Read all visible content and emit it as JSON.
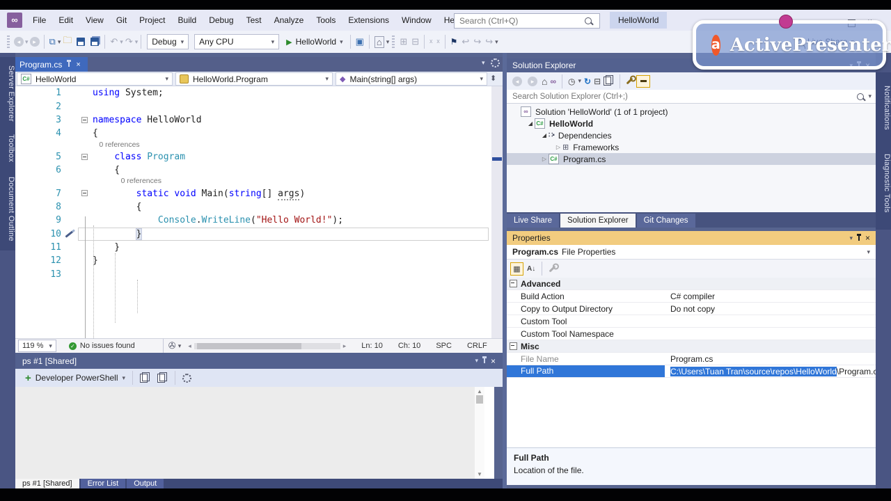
{
  "window": {
    "search_placeholder": "Search (Ctrl+Q)",
    "project_chip": "HelloWorld",
    "vs_logo": "VS"
  },
  "menu_items": [
    "File",
    "Edit",
    "View",
    "Git",
    "Project",
    "Build",
    "Debug",
    "Test",
    "Analyze",
    "Tools",
    "Extensions",
    "Window",
    "Help"
  ],
  "toolbar": {
    "config": "Debug",
    "platform": "Any CPU",
    "run_target": "HelloWorld",
    "live_share": "Live Share"
  },
  "watermark": {
    "brand": "ActivePresenter",
    "logo_letter": "a"
  },
  "left_strip": [
    "Server Explorer",
    "Toolbox",
    "Document Outline"
  ],
  "right_strip": [
    "Notifications",
    "Diagnostic Tools"
  ],
  "editor": {
    "tab": "Program.cs",
    "nav": [
      "HelloWorld",
      "HelloWorld.Program",
      "Main(string[] args)"
    ],
    "codelens_label": "0 references",
    "rows": [
      {
        "t": "code",
        "n": "1",
        "segs": [
          [
            "k",
            "using"
          ],
          [
            "p",
            " System;"
          ]
        ]
      },
      {
        "t": "code",
        "n": "2",
        "segs": []
      },
      {
        "t": "code",
        "n": "3",
        "fold": true,
        "segs": [
          [
            "k",
            "namespace"
          ],
          [
            "p",
            " HelloWorld"
          ]
        ]
      },
      {
        "t": "code",
        "n": "4",
        "segs": [
          [
            "p",
            "{"
          ]
        ]
      },
      {
        "t": "lens",
        "indent": 4
      },
      {
        "t": "code",
        "n": "5",
        "fold": true,
        "segs": [
          [
            "p",
            "    "
          ],
          [
            "k",
            "class"
          ],
          [
            "p",
            " "
          ],
          [
            "ty",
            "Program"
          ]
        ]
      },
      {
        "t": "code",
        "n": "6",
        "segs": [
          [
            "p",
            "    {"
          ]
        ]
      },
      {
        "t": "lens",
        "indent": 8
      },
      {
        "t": "code",
        "n": "7",
        "fold": true,
        "segs": [
          [
            "p",
            "        "
          ],
          [
            "k",
            "static"
          ],
          [
            "p",
            " "
          ],
          [
            "k",
            "void"
          ],
          [
            "p",
            " Main("
          ],
          [
            "k",
            "string"
          ],
          [
            "p",
            "[] "
          ],
          [
            "u",
            "args"
          ],
          [
            "p",
            ")"
          ]
        ]
      },
      {
        "t": "code",
        "n": "8",
        "segs": [
          [
            "p",
            "        {"
          ]
        ]
      },
      {
        "t": "code",
        "n": "9",
        "segs": [
          [
            "p",
            "            "
          ],
          [
            "ty",
            "Console"
          ],
          [
            "p",
            "."
          ],
          [
            "ty",
            "WriteLine"
          ],
          [
            "p",
            "("
          ],
          [
            "s",
            "\"Hello World!\""
          ],
          [
            "p",
            ");"
          ]
        ]
      },
      {
        "t": "code",
        "n": "10",
        "current": true,
        "brush": true,
        "segs": [
          [
            "p",
            "        "
          ],
          [
            "pm",
            "}"
          ]
        ]
      },
      {
        "t": "code",
        "n": "11",
        "segs": [
          [
            "p",
            "    }"
          ]
        ]
      },
      {
        "t": "code",
        "n": "12",
        "segs": [
          [
            "p",
            "}"
          ]
        ]
      },
      {
        "t": "code",
        "n": "13",
        "segs": []
      }
    ],
    "status": {
      "zoom": "119 %",
      "issues": "No issues found",
      "ln": "Ln: 10",
      "ch": "Ch: 10",
      "spc": "SPC",
      "crlf": "CRLF"
    }
  },
  "terminal": {
    "title": "ps #1 [Shared]",
    "shell_label": "Developer PowerShell",
    "tabs": [
      {
        "label": "ps #1 [Shared]",
        "active": true
      },
      {
        "label": "Error List",
        "active": false
      },
      {
        "label": "Output",
        "active": false
      }
    ]
  },
  "solution_explorer": {
    "title": "Solution Explorer",
    "search_placeholder": "Search Solution Explorer (Ctrl+;)",
    "tree": [
      {
        "label": "Solution 'HelloWorld' (1 of 1 project)",
        "icon": "sln",
        "lvl": 0,
        "arrow": null,
        "bold": false,
        "selected": false
      },
      {
        "label": "HelloWorld",
        "icon": "csproj",
        "lvl": 1,
        "arrow": "exp",
        "bold": true,
        "selected": false
      },
      {
        "label": "Dependencies",
        "icon": "deps",
        "lvl": 2,
        "arrow": "exp",
        "bold": false,
        "selected": false
      },
      {
        "label": "Frameworks",
        "icon": "fw",
        "lvl": 3,
        "arrow": "col",
        "bold": false,
        "selected": false
      },
      {
        "label": "Program.cs",
        "icon": "cs",
        "lvl": 2,
        "arrow": "col",
        "bold": false,
        "selected": true
      }
    ],
    "tabs": [
      {
        "label": "Live Share",
        "active": false
      },
      {
        "label": "Solution Explorer",
        "active": true
      },
      {
        "label": "Git Changes",
        "active": false
      }
    ]
  },
  "properties": {
    "title": "Properties",
    "object_name": "Program.cs",
    "object_suffix": "File Properties",
    "rows": [
      {
        "type": "cat",
        "label": "Advanced"
      },
      {
        "type": "row",
        "label": "Build Action",
        "value": "C# compiler"
      },
      {
        "type": "row",
        "label": "Copy to Output Directory",
        "value": "Do not copy"
      },
      {
        "type": "row",
        "label": "Custom Tool",
        "value": ""
      },
      {
        "type": "row",
        "label": "Custom Tool Namespace",
        "value": ""
      },
      {
        "type": "cat",
        "label": "Misc"
      },
      {
        "type": "row",
        "label": "File Name",
        "value": "Program.cs",
        "muted": true
      },
      {
        "type": "row",
        "label": "Full Path",
        "selected": true,
        "value_selected": "C:\\Users\\Tuan Tran\\source\\repos\\HelloWorld",
        "value_rest": "\\Program.cs"
      }
    ],
    "description_title": "Full Path",
    "description_text": "Location of the file."
  }
}
